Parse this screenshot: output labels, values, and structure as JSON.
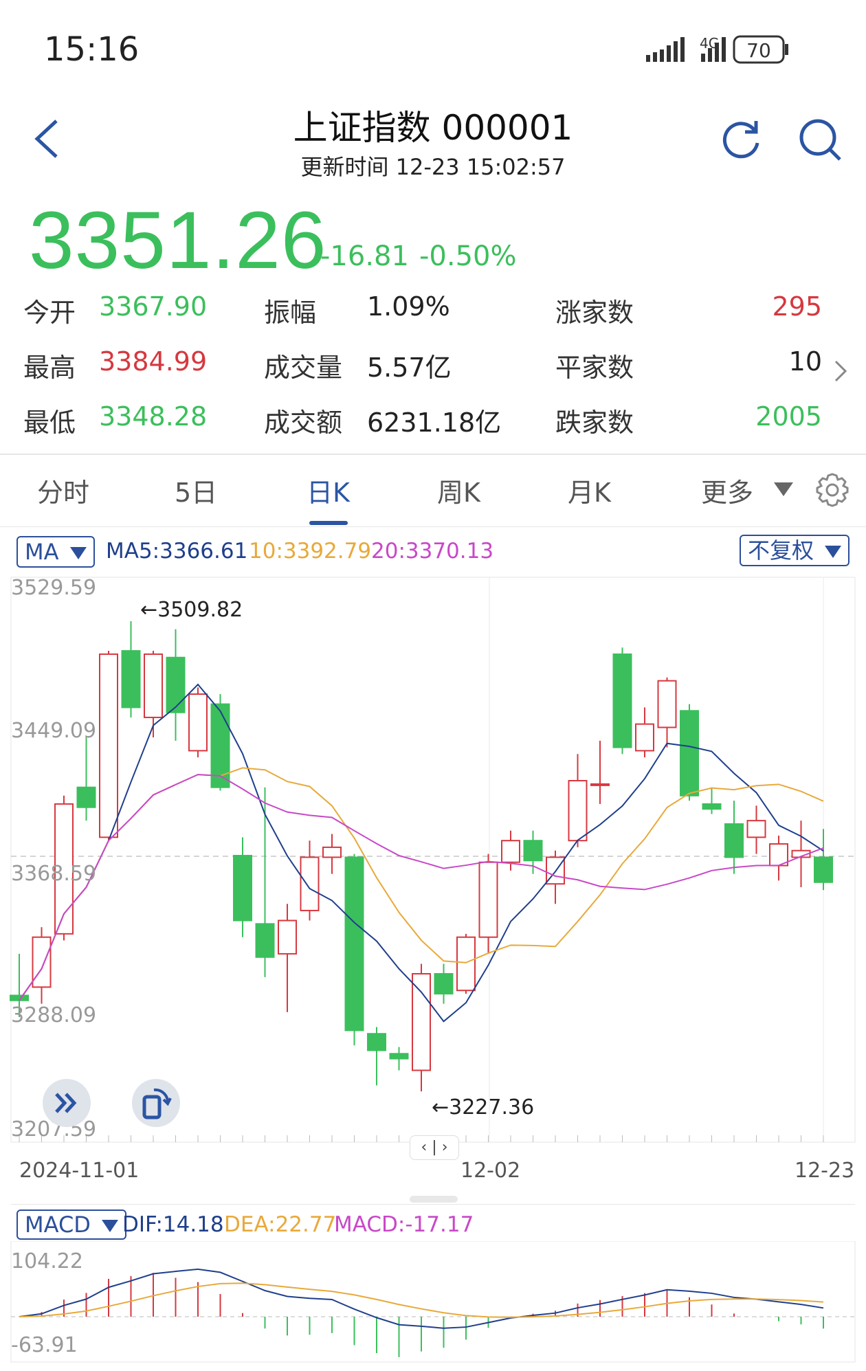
{
  "status_bar": {
    "time": "15:16",
    "network": "4G",
    "battery": "70"
  },
  "header": {
    "title": "上证指数 000001",
    "subtitle": "更新时间 12-23 15:02:57"
  },
  "quote": {
    "price": "3351.26",
    "change": "-16.81",
    "change_pct": "-0.50%"
  },
  "stats": [
    {
      "label": "今开",
      "value": "3367.90",
      "color": "g"
    },
    {
      "label": "振幅",
      "value": "1.09%",
      "color": "k"
    },
    {
      "label": "涨家数",
      "value": "295",
      "color": "r"
    },
    {
      "label": "最高",
      "value": "3384.99",
      "color": "r"
    },
    {
      "label": "成交量",
      "value": "5.57亿",
      "color": "k"
    },
    {
      "label": "平家数",
      "value": "10",
      "color": "k"
    },
    {
      "label": "最低",
      "value": "3348.28",
      "color": "g"
    },
    {
      "label": "成交额",
      "value": "6231.18亿",
      "color": "k"
    },
    {
      "label": "跌家数",
      "value": "2005",
      "color": "g"
    }
  ],
  "tabs": [
    "分时",
    "5日",
    "日K",
    "周K",
    "月K",
    "更多"
  ],
  "active_tab": "日K",
  "kline": {
    "indicator": "MA",
    "ma5": "MA5:3366.61",
    "ma10": "10:3392.79",
    "ma20": "20:3370.13",
    "adjust": "不复权",
    "y_labels": [
      "3529.59",
      "3449.09",
      "3368.59",
      "3288.09",
      "3207.59"
    ],
    "x_labels": [
      "2024-11-01",
      "12-02",
      "12-23"
    ],
    "high_mark": "←3509.82",
    "low_mark": "←3227.36"
  },
  "macd": {
    "indicator": "MACD",
    "dif": "DIF:14.18",
    "dea": "DEA:22.77",
    "macd": "MACD:-17.17",
    "y_top": "104.22",
    "y_bottom": "-63.91"
  },
  "colors": {
    "up": "#d6383f",
    "down": "#3bbf5c",
    "accent": "#2b55a3",
    "ma5": "#1f3f8c",
    "ma10": "#e8a93a",
    "ma20": "#c848c8"
  },
  "chart_data": {
    "type": "candlestick",
    "ylim": [
      3207.59,
      3529.59
    ],
    "candles": [
      {
        "o": 3285,
        "c": 3282,
        "h": 3310,
        "l": 3272
      },
      {
        "o": 3290,
        "c": 3320,
        "h": 3326,
        "l": 3280
      },
      {
        "o": 3322,
        "c": 3400,
        "h": 3405,
        "l": 3318
      },
      {
        "o": 3410,
        "c": 3398,
        "h": 3440,
        "l": 3390
      },
      {
        "o": 3380,
        "c": 3490,
        "h": 3492,
        "l": 3378
      },
      {
        "o": 3492,
        "c": 3458,
        "h": 3509.82,
        "l": 3452
      },
      {
        "o": 3452,
        "c": 3490,
        "h": 3492,
        "l": 3440
      },
      {
        "o": 3488,
        "c": 3455,
        "h": 3505,
        "l": 3438
      },
      {
        "o": 3432,
        "c": 3466,
        "h": 3470,
        "l": 3428
      },
      {
        "o": 3460,
        "c": 3410,
        "h": 3466,
        "l": 3408
      },
      {
        "o": 3369,
        "c": 3330,
        "h": 3380,
        "l": 3320
      },
      {
        "o": 3328,
        "c": 3308,
        "h": 3410,
        "l": 3296
      },
      {
        "o": 3310,
        "c": 3330,
        "h": 3340,
        "l": 3275
      },
      {
        "o": 3336,
        "c": 3368,
        "h": 3378,
        "l": 3330
      },
      {
        "o": 3368,
        "c": 3374,
        "h": 3382,
        "l": 3358
      },
      {
        "o": 3368,
        "c": 3264,
        "h": 3370,
        "l": 3255
      },
      {
        "o": 3262,
        "c": 3252,
        "h": 3266,
        "l": 3231
      },
      {
        "o": 3250,
        "c": 3247,
        "h": 3254,
        "l": 3240
      },
      {
        "o": 3240,
        "c": 3298,
        "h": 3304,
        "l": 3227.36
      },
      {
        "o": 3298,
        "c": 3286,
        "h": 3304,
        "l": 3280
      },
      {
        "o": 3288,
        "c": 3320,
        "h": 3322,
        "l": 3286
      },
      {
        "o": 3320,
        "c": 3365,
        "h": 3370,
        "l": 3310
      },
      {
        "o": 3365,
        "c": 3378,
        "h": 3384,
        "l": 3360
      },
      {
        "o": 3378,
        "c": 3366,
        "h": 3384,
        "l": 3358
      },
      {
        "o": 3352,
        "c": 3368,
        "h": 3372,
        "l": 3340
      },
      {
        "o": 3378,
        "c": 3414,
        "h": 3430,
        "l": 3374
      },
      {
        "o": 3412,
        "c": 3412,
        "h": 3438,
        "l": 3400
      },
      {
        "o": 3490,
        "c": 3434,
        "h": 3494,
        "l": 3430
      },
      {
        "o": 3432,
        "c": 3448,
        "h": 3458,
        "l": 3428
      },
      {
        "o": 3446,
        "c": 3474,
        "h": 3476,
        "l": 3434
      },
      {
        "o": 3456,
        "c": 3405,
        "h": 3460,
        "l": 3402
      },
      {
        "o": 3400,
        "c": 3397,
        "h": 3410,
        "l": 3394
      },
      {
        "o": 3388,
        "c": 3368,
        "h": 3402,
        "l": 3358
      },
      {
        "o": 3380,
        "c": 3390,
        "h": 3399,
        "l": 3370
      },
      {
        "o": 3363,
        "c": 3376,
        "h": 3381,
        "l": 3354
      },
      {
        "o": 3368,
        "c": 3372,
        "h": 3390,
        "l": 3350
      },
      {
        "o": 3368,
        "c": 3353,
        "h": 3384.99,
        "l": 3348.28
      }
    ]
  }
}
